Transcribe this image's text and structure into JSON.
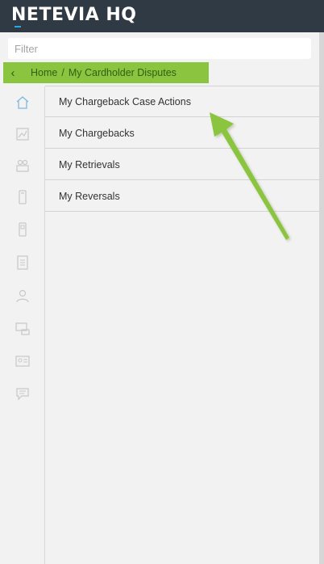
{
  "header": {
    "logo_text": "NETEVIA HQ"
  },
  "filter": {
    "placeholder": "Filter",
    "value": ""
  },
  "breadcrumb": {
    "home": "Home",
    "separator": "/",
    "current": "My Cardholder Disputes"
  },
  "sidebar": {
    "icons": [
      "home-icon",
      "chart-icon",
      "team-icon",
      "phone-icon",
      "mobile-icon",
      "document-icon",
      "user-icon",
      "terminal-icon",
      "id-card-icon",
      "chat-icon"
    ]
  },
  "menu": {
    "items": [
      {
        "label": "My Chargeback Case Actions"
      },
      {
        "label": "My Chargebacks"
      },
      {
        "label": "My Retrievals"
      },
      {
        "label": "My Reversals"
      }
    ]
  },
  "annotation": {
    "arrow_color": "#8bc53f"
  },
  "colors": {
    "header_bg": "#2f3a45",
    "breadcrumb_bg": "#8bc53f",
    "logo_accent": "#29a9e1",
    "background": "#f2f2f2"
  }
}
